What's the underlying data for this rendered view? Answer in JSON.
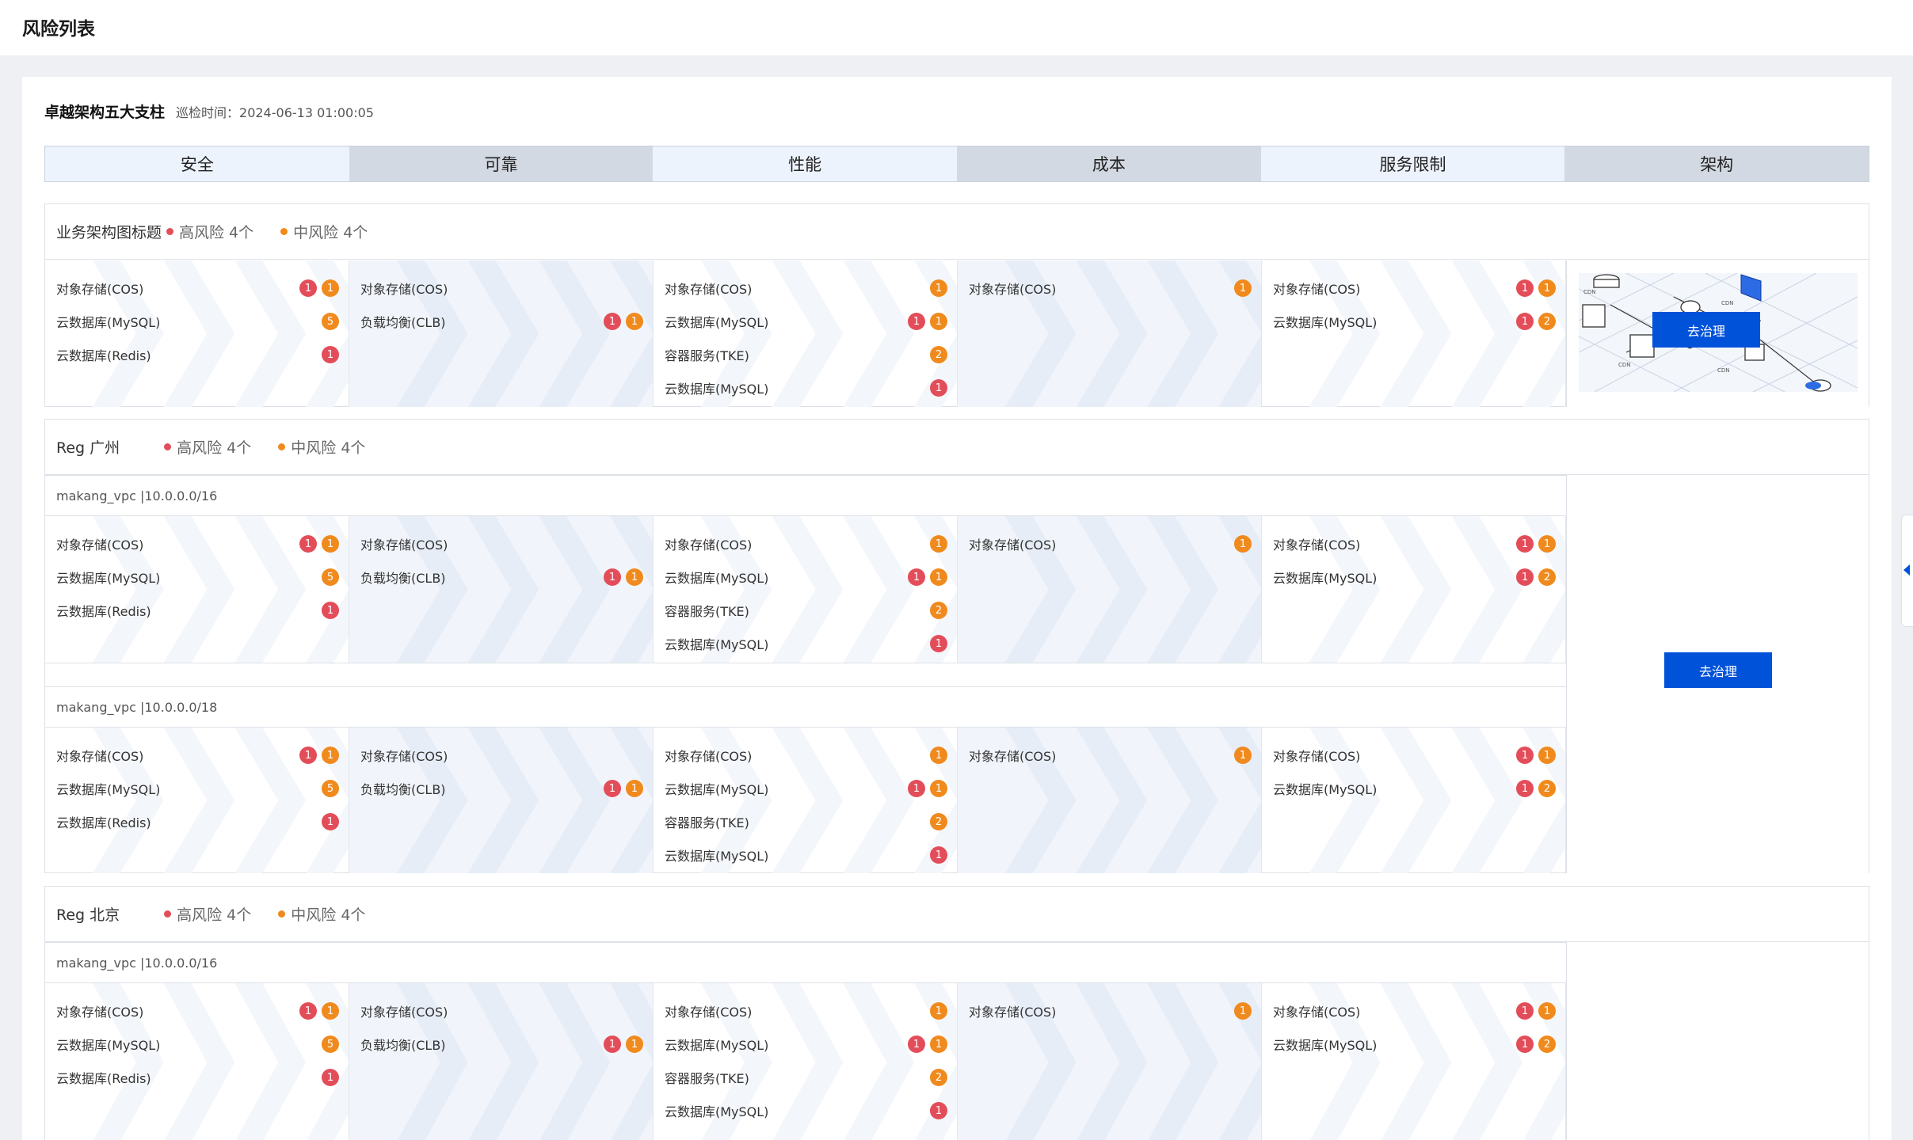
{
  "page_title": "风险列表",
  "header": {
    "title": "卓越架构五大支柱",
    "inspection_time": "巡检时间：2024-06-13 01:00:05"
  },
  "tabs": [
    "安全",
    "可靠",
    "性能",
    "成本",
    "服务限制",
    "架构"
  ],
  "colors": {
    "high": "#e34d59",
    "medium": "#f08a1d",
    "primary": "#0052d9"
  },
  "columns": [
    [
      {
        "name": "对象存储(COS)",
        "badges": [
          {
            "t": "r",
            "v": "1"
          },
          {
            "t": "o",
            "v": "1"
          }
        ]
      },
      {
        "name": "云数据库(MySQL)",
        "badges": [
          {
            "t": "o",
            "v": "5"
          }
        ]
      },
      {
        "name": "云数据库(Redis)",
        "badges": [
          {
            "t": "r",
            "v": "1"
          }
        ]
      }
    ],
    [
      {
        "name": "对象存储(COS)",
        "badges": []
      },
      {
        "name": "负载均衡(CLB)",
        "badges": [
          {
            "t": "r",
            "v": "1"
          },
          {
            "t": "o",
            "v": "1"
          }
        ]
      }
    ],
    [
      {
        "name": "对象存储(COS)",
        "badges": [
          {
            "t": "o",
            "v": "1"
          }
        ]
      },
      {
        "name": "云数据库(MySQL)",
        "badges": [
          {
            "t": "r",
            "v": "1"
          },
          {
            "t": "o",
            "v": "1"
          }
        ]
      },
      {
        "name": "容器服务(TKE)",
        "badges": [
          {
            "t": "o",
            "v": "2"
          }
        ]
      },
      {
        "name": "云数据库(MySQL)",
        "badges": [
          {
            "t": "r",
            "v": "1"
          }
        ]
      }
    ],
    [
      {
        "name": "对象存储(COS)",
        "badges": [
          {
            "t": "o",
            "v": "1"
          }
        ]
      }
    ],
    [
      {
        "name": "对象存储(COS)",
        "badges": [
          {
            "t": "r",
            "v": "1"
          },
          {
            "t": "o",
            "v": "1"
          }
        ]
      },
      {
        "name": "云数据库(MySQL)",
        "badges": [
          {
            "t": "r",
            "v": "1"
          },
          {
            "t": "o",
            "v": "2"
          }
        ]
      }
    ]
  ],
  "sections": [
    {
      "name": "业务架构图标题",
      "high": "高风险 4个",
      "medium": "中风险 4个",
      "action": "去治理"
    },
    {
      "name": "Reg 广州",
      "high": "高风险 4个",
      "medium": "中风险 4个",
      "action": "去治理",
      "vpcs": [
        "makang_vpc |10.0.0.0/16",
        "makang_vpc |10.0.0.0/18"
      ]
    },
    {
      "name": "Reg 北京",
      "high": "高风险 4个",
      "medium": "中风险 4个",
      "vpcs": [
        "makang_vpc |10.0.0.0/16"
      ]
    }
  ],
  "diagram_labels": [
    "CDN",
    "CDN",
    "CDN",
    "CDN"
  ]
}
